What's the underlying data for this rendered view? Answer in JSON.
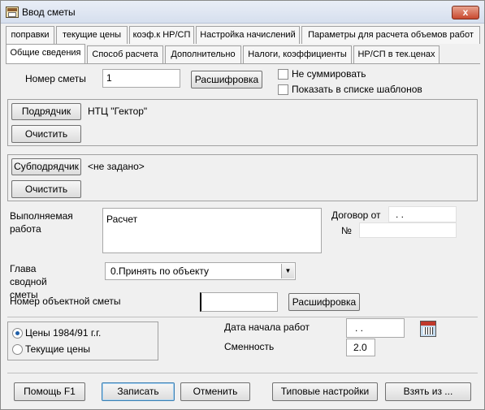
{
  "window": {
    "title": "Ввод сметы",
    "close_label": "x"
  },
  "tabs_row1": [
    "поправки",
    "текущие цены",
    "коэф.к НР/СП",
    "Настройка начислений",
    "Параметры для расчета объемов работ"
  ],
  "tabs_row2": [
    "Общие сведения",
    "Способ расчета",
    "Дополнительно",
    "Налоги, коэффициенты",
    "НР/СП в тек.ценах"
  ],
  "active_tab": "Общие сведения",
  "smeta": {
    "number_label": "Номер сметы",
    "number_value": "1",
    "decode_button": "Расшифровка",
    "no_sum_label": "Не суммировать",
    "show_in_templates_label": "Показать в списке шаблонов"
  },
  "contractor": {
    "button": "Подрядчик",
    "value": "НТЦ \"Гектор\"",
    "clear_button": "Очистить"
  },
  "subcontractor": {
    "button": "Субподрядчик",
    "value": "<не задано>",
    "clear_button": "Очистить"
  },
  "work": {
    "label": "Выполняемая работа",
    "value": "Расчет",
    "contract_label": "Договор от",
    "contract_date": ". .",
    "number_symbol": "№",
    "contract_number": ""
  },
  "chapter": {
    "label": "Глава сводной сметы",
    "selected": "0.Принять по объекту"
  },
  "object_smeta": {
    "label": "Номер объектной сметы",
    "value": "",
    "decode_button": "Расшифровка"
  },
  "prices": {
    "option1": "Цены 1984/91 г.г.",
    "option2": "Текущие цены",
    "selected": 1
  },
  "start": {
    "label": "Дата начала работ",
    "value": ". .",
    "shift_label": "Сменность",
    "shift_value": "2.0"
  },
  "footer": {
    "help": "Помощь F1",
    "save": "Записать",
    "cancel": "Отменить",
    "typical": "Типовые настройки",
    "take_from": "Взять из ..."
  },
  "colors": {
    "window_bg": "#f0f0f0",
    "close_button": "#c8492f",
    "focus_border": "#3c7fb1"
  },
  "icons": {
    "app": "app-icon",
    "calendar": "calendar-icon",
    "dropdown": "chevron-down-icon"
  }
}
